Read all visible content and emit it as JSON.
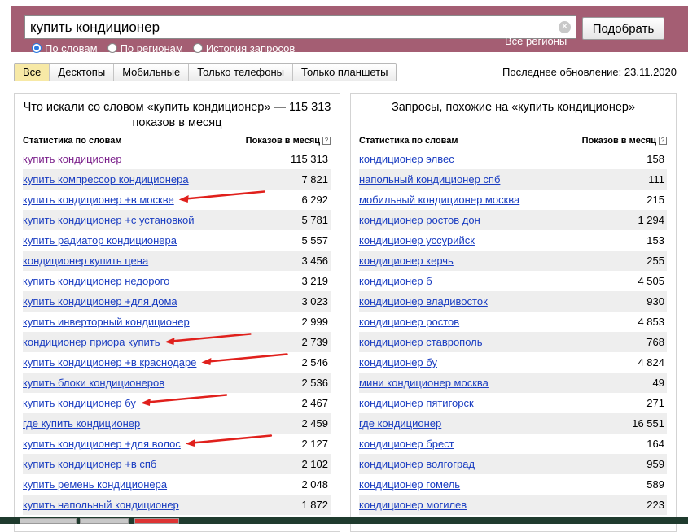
{
  "search": {
    "query": "купить кондиционер",
    "submit_label": "Подобрать",
    "clear_icon": "close-circle-icon"
  },
  "modes": [
    {
      "label": "По словам",
      "checked": true
    },
    {
      "label": "По регионам",
      "checked": false
    },
    {
      "label": "История запросов",
      "checked": false
    }
  ],
  "regions_link": "Все регионы",
  "tabs": [
    {
      "label": "Все",
      "active": true
    },
    {
      "label": "Десктопы",
      "active": false
    },
    {
      "label": "Мобильные",
      "active": false
    },
    {
      "label": "Только телефоны",
      "active": false
    },
    {
      "label": "Только планшеты",
      "active": false
    }
  ],
  "last_update": "Последнее обновление: 23.11.2020",
  "left_panel": {
    "title": "Что искали со словом «купить кондиционер» — 115 313 показов в месяц",
    "col_phrase": "Статистика по словам",
    "col_count": "Показов в месяц",
    "rows": [
      {
        "phrase": "купить кондиционер",
        "count": "115 313",
        "visited": true
      },
      {
        "phrase": "купить компрессор кондиционера",
        "count": "7 821",
        "visited": false
      },
      {
        "phrase": "купить кондиционер +в москве",
        "count": "6 292",
        "visited": false
      },
      {
        "phrase": "купить кондиционер +с установкой",
        "count": "5 781",
        "visited": false
      },
      {
        "phrase": "купить радиатор кондиционера",
        "count": "5 557",
        "visited": false
      },
      {
        "phrase": "кондиционер купить цена",
        "count": "3 456",
        "visited": false
      },
      {
        "phrase": "купить кондиционер недорого",
        "count": "3 219",
        "visited": false
      },
      {
        "phrase": "купить кондиционер +для дома",
        "count": "3 023",
        "visited": false
      },
      {
        "phrase": "купить инверторный кондиционер",
        "count": "2 999",
        "visited": false
      },
      {
        "phrase": "кондиционер приора купить",
        "count": "2 739",
        "visited": false
      },
      {
        "phrase": "купить кондиционер +в краснодаре",
        "count": "2 546",
        "visited": false
      },
      {
        "phrase": "купить блоки кондиционеров",
        "count": "2 536",
        "visited": false
      },
      {
        "phrase": "купить кондиционер бу",
        "count": "2 467",
        "visited": false
      },
      {
        "phrase": "где купить кондиционер",
        "count": "2 459",
        "visited": false
      },
      {
        "phrase": "купить кондиционер +для волос",
        "count": "2 127",
        "visited": false
      },
      {
        "phrase": "купить кондиционер +в спб",
        "count": "2 102",
        "visited": false
      },
      {
        "phrase": "купить ремень кондиционера",
        "count": "2 048",
        "visited": false
      },
      {
        "phrase": "купить напольный кондиционер",
        "count": "1 872",
        "visited": false
      }
    ]
  },
  "right_panel": {
    "title": "Запросы, похожие на «купить кондиционер»",
    "col_phrase": "Статистика по словам",
    "col_count": "Показов в месяц",
    "rows": [
      {
        "phrase": "кондиционер элвес",
        "count": "158"
      },
      {
        "phrase": "напольный кондиционер спб",
        "count": "111"
      },
      {
        "phrase": "мобильный кондиционер москва",
        "count": "215"
      },
      {
        "phrase": "кондиционер ростов дон",
        "count": "1 294"
      },
      {
        "phrase": "кондиционер уссурийск",
        "count": "153"
      },
      {
        "phrase": "кондиционер керчь",
        "count": "255"
      },
      {
        "phrase": "кондиционер б",
        "count": "4 505"
      },
      {
        "phrase": "кондиционер владивосток",
        "count": "930"
      },
      {
        "phrase": "кондиционер ростов",
        "count": "4 853"
      },
      {
        "phrase": "кондиционер ставрополь",
        "count": "768"
      },
      {
        "phrase": "кондиционер бу",
        "count": "4 824"
      },
      {
        "phrase": "мини кондиционер москва",
        "count": "49"
      },
      {
        "phrase": "кондиционер пятигорск",
        "count": "271"
      },
      {
        "phrase": "где кондиционер",
        "count": "16 551"
      },
      {
        "phrase": "кондиционер брест",
        "count": "164"
      },
      {
        "phrase": "кондиционер волгоград",
        "count": "959"
      },
      {
        "phrase": "кондиционер гомель",
        "count": "589"
      },
      {
        "phrase": "кондиционер могилев",
        "count": "223"
      }
    ]
  },
  "annotations": {
    "arrow_color": "#e0201c",
    "arrow_rows": [
      2,
      9,
      10,
      12,
      14
    ]
  },
  "colors": {
    "header_band": "#a45e73",
    "link": "#1a3dc1",
    "visited_link": "#7a1e8a",
    "active_tab": "#f7e9a6",
    "row_stripe": "#eeeeee"
  }
}
